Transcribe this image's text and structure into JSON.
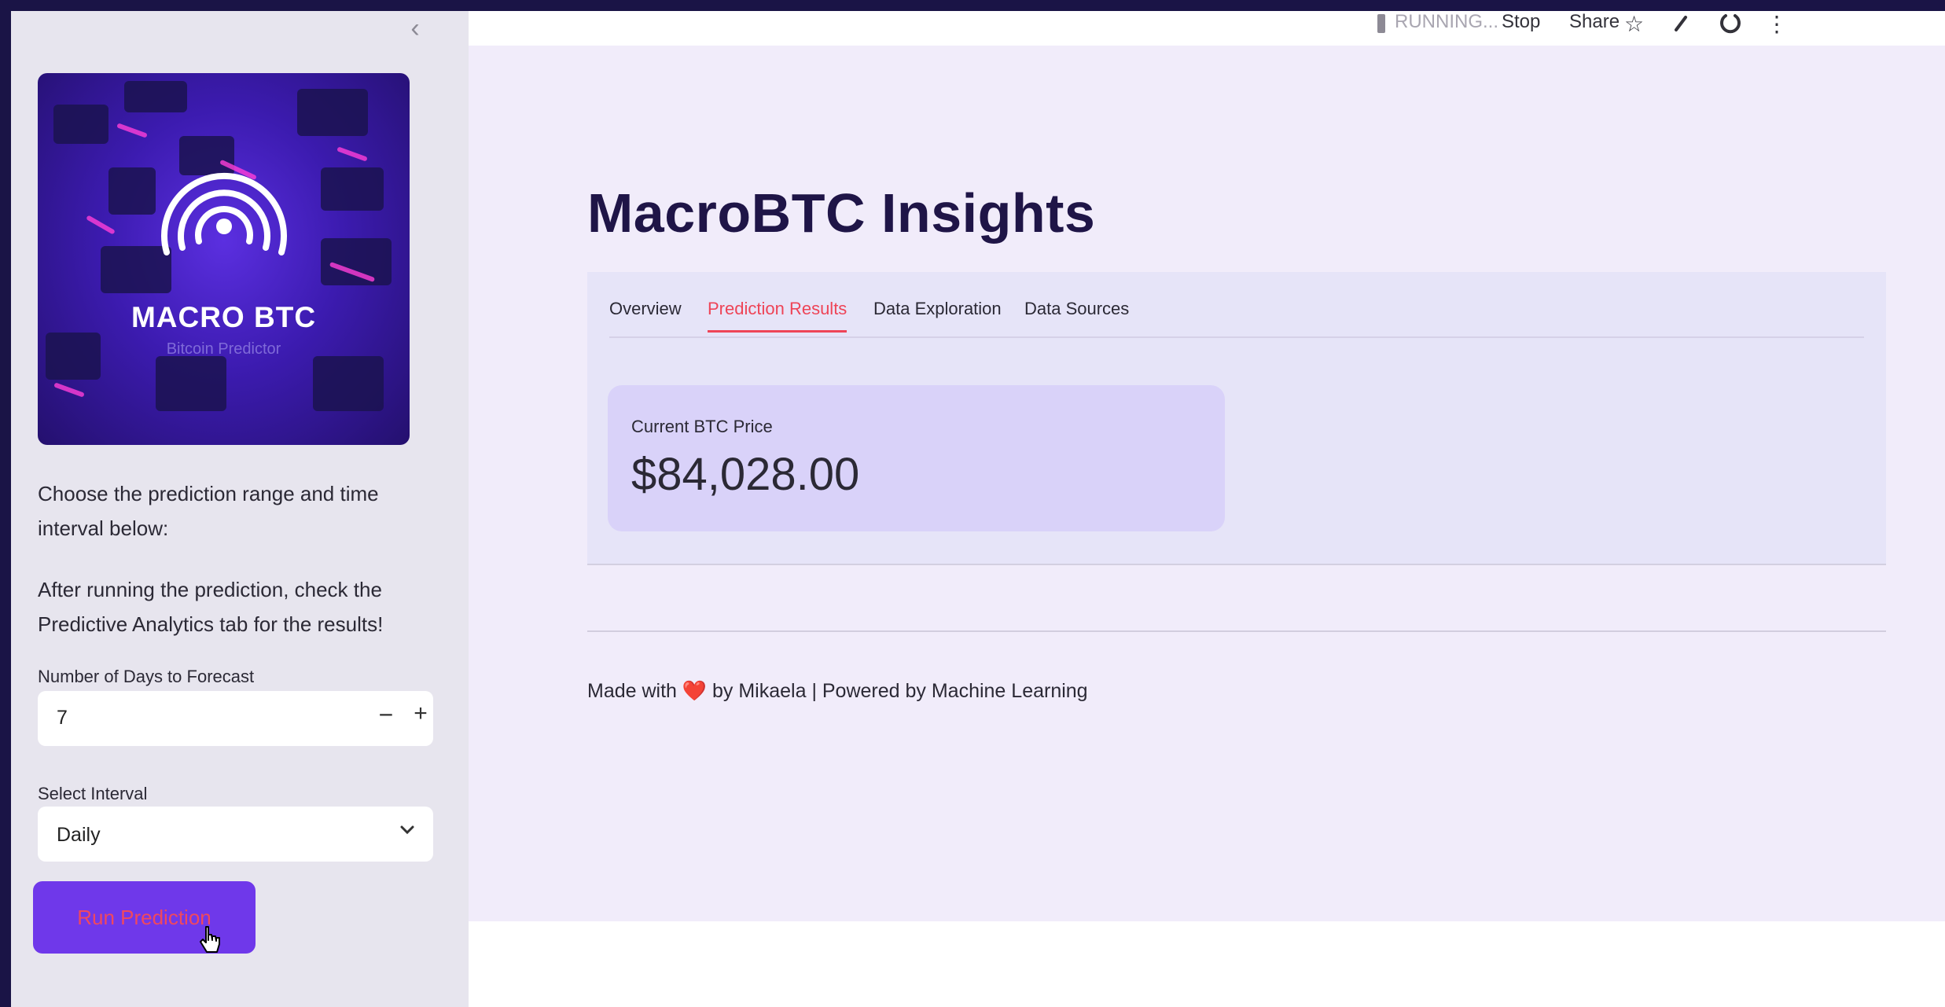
{
  "sidebar": {
    "collapse_glyph": "‹",
    "logo": {
      "title": "MACRO BTC",
      "subtitle": "Bitcoin Predictor"
    },
    "intro_text": "Choose the prediction range and time interval below:",
    "hint_text": "After running the prediction, check the Predictive Analytics tab for the results!",
    "days_label": "Number of Days to Forecast",
    "days_value": "7",
    "minus_label": "−",
    "plus_label": "+",
    "interval_label": "Select Interval",
    "interval_value": "Daily",
    "run_button": "Run Prediction"
  },
  "toolbar": {
    "status": "RUNNING...",
    "stop": "Stop",
    "share": "Share"
  },
  "main": {
    "title": "MacroBTC Insights",
    "tabs": [
      {
        "label": "Overview"
      },
      {
        "label": "Prediction Results"
      },
      {
        "label": "Data Exploration"
      },
      {
        "label": "Data Sources"
      }
    ],
    "active_tab": "Prediction Results",
    "metric": {
      "label": "Current BTC Price",
      "value": "$84,028.00"
    },
    "footer": {
      "before": "Made with",
      "heart": "❤️",
      "after": "by Mikaela | Powered by Machine Learning"
    }
  },
  "colors": {
    "accent": "#ee4457",
    "button": "#6f38ea",
    "title": "#1f1547",
    "background": "#f1ecfa"
  },
  "icons": [
    "chevron-left-icon",
    "star-icon",
    "pencil-icon",
    "github-icon",
    "more-vert-icon",
    "chevron-down-icon",
    "pointer-cursor-icon"
  ]
}
